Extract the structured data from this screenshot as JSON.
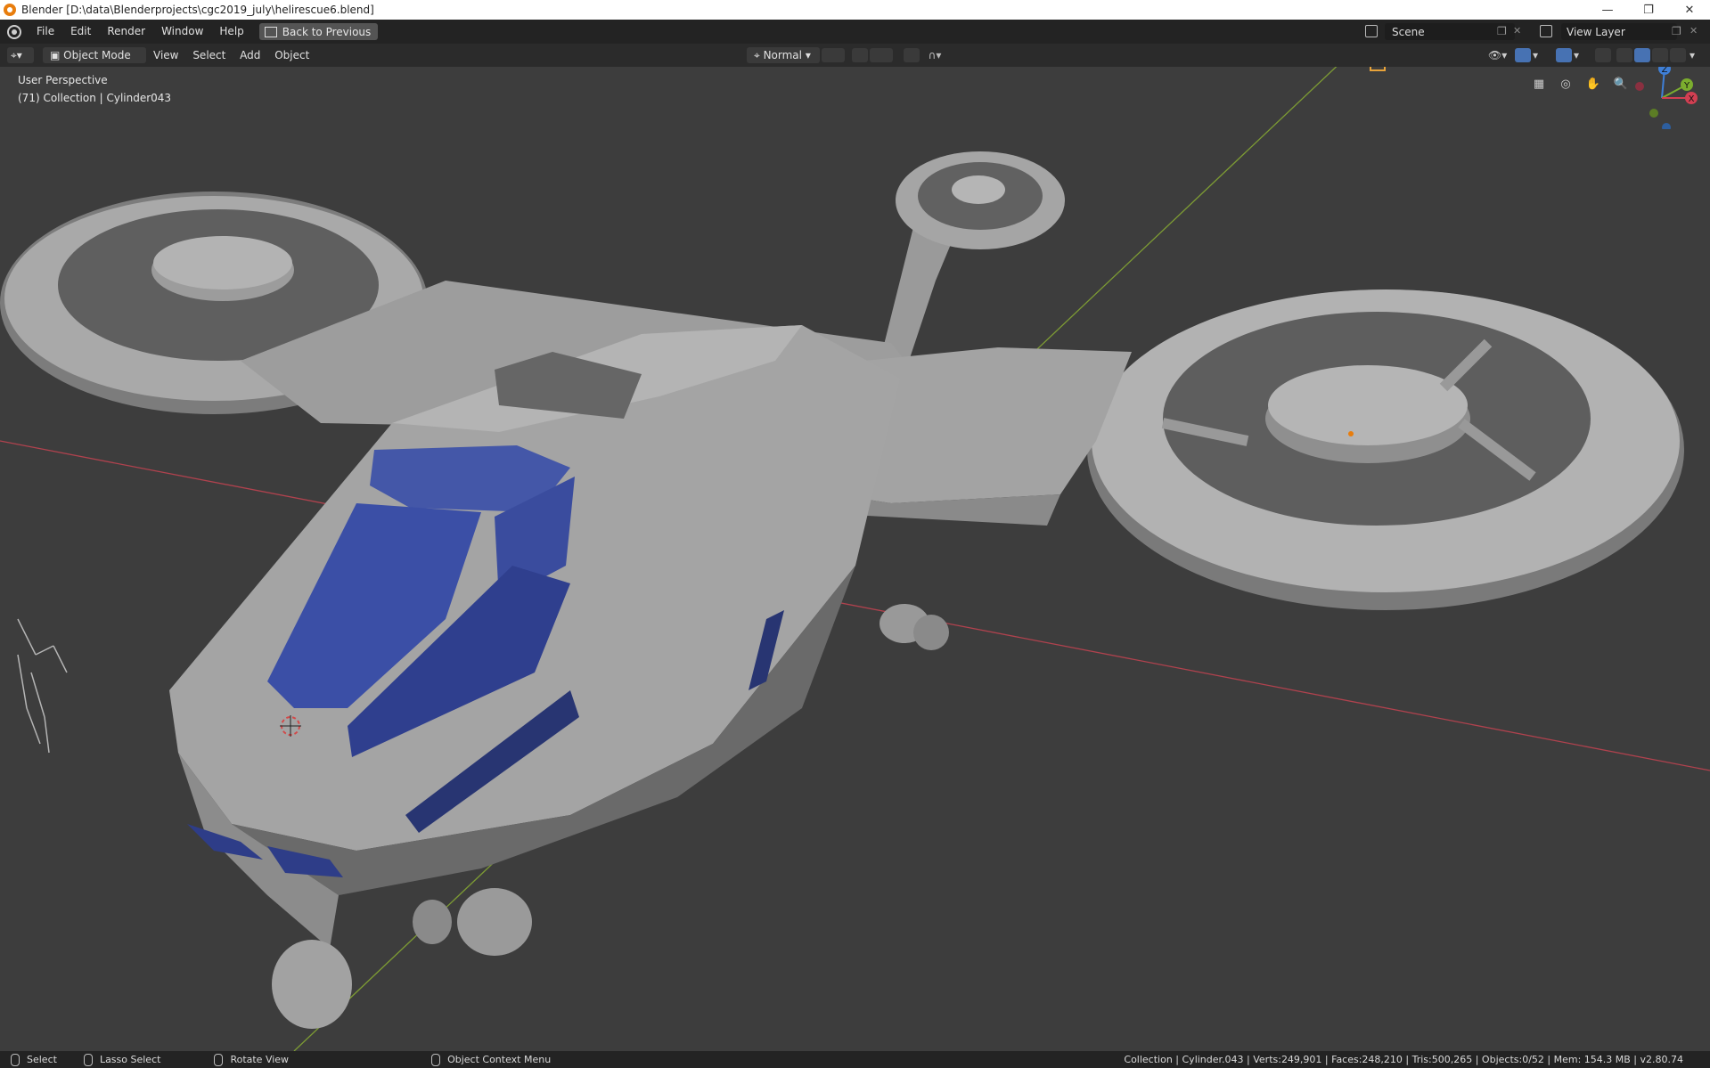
{
  "window": {
    "title": "Blender [D:\\data\\Blenderprojects\\cgc2019_july\\helirescue6.blend]"
  },
  "menu": {
    "items": [
      "File",
      "Edit",
      "Render",
      "Window",
      "Help"
    ],
    "back_button": "Back to Previous"
  },
  "scene": {
    "name": "Scene"
  },
  "view_layer": {
    "name": "View Layer"
  },
  "viewport_header": {
    "mode": "Object Mode",
    "menus": [
      "View",
      "Select",
      "Add",
      "Object"
    ],
    "orientation": "Normal"
  },
  "viewport": {
    "perspective": "User Perspective",
    "collection_info": "(71) Collection | Cylinder043",
    "gizmo": {
      "z": "Z",
      "y": "Y",
      "x": "X"
    }
  },
  "statusbar": {
    "select": "Select",
    "lasso": "Lasso Select",
    "rotate": "Rotate View",
    "context": "Object Context Menu",
    "stats": "Collection | Cylinder.043 | Verts:249,901 | Faces:248,210 | Tris:500,265 | Objects:0/52 | Mem: 154.3 MB | v2.80.74"
  },
  "colors": {
    "accent_orange": "#e87d0d",
    "active_blue": "#4772b3",
    "axis_red": "#c04050",
    "axis_green": "#8fb03a"
  }
}
